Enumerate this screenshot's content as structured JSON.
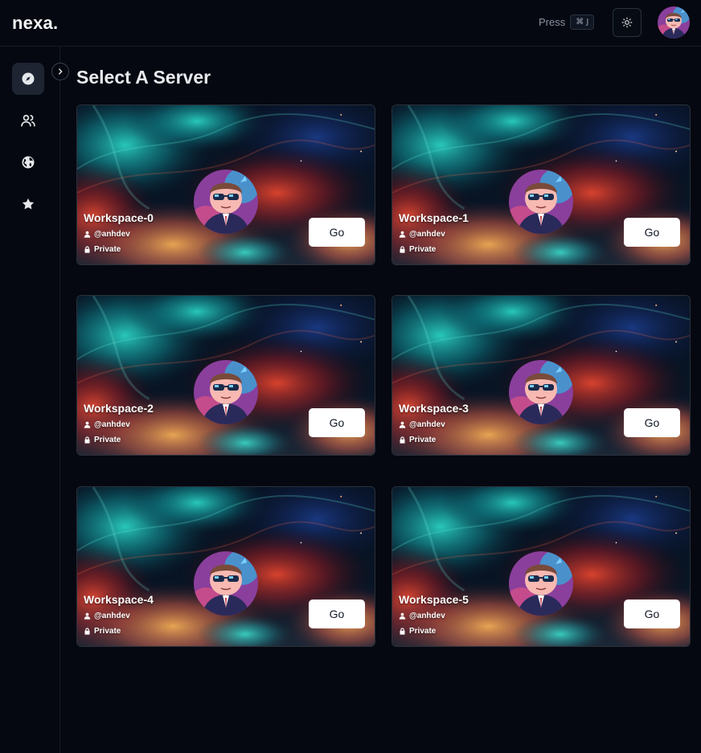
{
  "app": {
    "logo": "nexa."
  },
  "header": {
    "shortcut_prefix": "Press",
    "shortcut_keys": "⌘ J",
    "theme_toggle_icon": "sun-icon",
    "user_avatar_icon": "user-avatar"
  },
  "sidebar": {
    "items": [
      {
        "id": "discover",
        "icon": "compass-icon",
        "active": true
      },
      {
        "id": "friends",
        "icon": "users-icon",
        "active": false
      },
      {
        "id": "explore",
        "icon": "globe-icon",
        "active": false
      },
      {
        "id": "favorites",
        "icon": "star-icon",
        "active": false
      }
    ],
    "collapse_icon": "chevron-right-icon"
  },
  "main": {
    "title": "Select A Server",
    "servers": [
      {
        "name": "Workspace-0",
        "owner": "@anhdev",
        "privacy": "Private",
        "action": "Go"
      },
      {
        "name": "Workspace-1",
        "owner": "@anhdev",
        "privacy": "Private",
        "action": "Go"
      },
      {
        "name": "Workspace-2",
        "owner": "@anhdev",
        "privacy": "Private",
        "action": "Go"
      },
      {
        "name": "Workspace-3",
        "owner": "@anhdev",
        "privacy": "Private",
        "action": "Go"
      },
      {
        "name": "Workspace-4",
        "owner": "@anhdev",
        "privacy": "Private",
        "action": "Go"
      },
      {
        "name": "Workspace-5",
        "owner": "@anhdev",
        "privacy": "Private",
        "action": "Go"
      }
    ]
  },
  "colors": {
    "background": "#050810",
    "sidebar_active": "#1e2431",
    "card_border": "#2a303b",
    "button_bg": "#ffffff"
  }
}
